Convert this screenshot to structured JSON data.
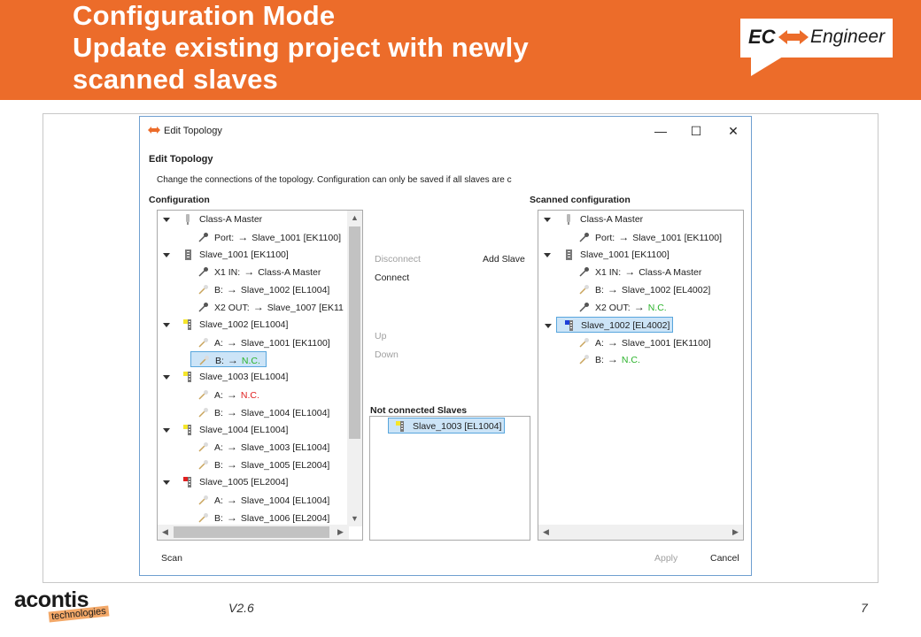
{
  "slide": {
    "title_lines": [
      "Configuration Mode",
      "Update existing project with newly",
      "scanned slaves"
    ],
    "version": "V2.6",
    "page_number": "7",
    "accent_color": "#ec6c2a"
  },
  "logo": {
    "ec": "EC",
    "engineer": "Engineer"
  },
  "brand": {
    "name": "acontis",
    "sub": "technologies"
  },
  "dialog": {
    "title": "Edit Topology",
    "heading": "Edit Topology",
    "description": "Change the connections of the topology. Configuration can only be saved if all slaves are c",
    "window_buttons": {
      "minimize": "—",
      "maximize": "☐",
      "close": "✕"
    },
    "configuration": {
      "label": "Configuration",
      "rows": [
        {
          "kind": "node",
          "icon": "master-icon",
          "text": "Class-A Master"
        },
        {
          "kind": "port",
          "icon": "port-connected-icon",
          "port": "Port:",
          "target": "Slave_1001 [EK1100]"
        },
        {
          "kind": "node",
          "icon": "slave-gray-icon",
          "text": "Slave_1001 [EK1100]"
        },
        {
          "kind": "port",
          "icon": "port-connected-icon",
          "port": "X1 IN:",
          "target": "Class-A Master"
        },
        {
          "kind": "port",
          "icon": "port-open-icon",
          "port": "B:",
          "target": "Slave_1002 [EL1004]"
        },
        {
          "kind": "port",
          "icon": "port-connected-icon",
          "port": "X2 OUT:",
          "target": "Slave_1007 [EK11"
        },
        {
          "kind": "node",
          "icon": "slave-yellow-icon",
          "text": "Slave_1002 [EL1004]"
        },
        {
          "kind": "port",
          "icon": "port-open-icon",
          "port": "A:",
          "target": "Slave_1001 [EK1100]"
        },
        {
          "kind": "port",
          "icon": "port-open-icon",
          "port": "B:",
          "target": "N.C.",
          "status": "green",
          "selected": true
        },
        {
          "kind": "node",
          "icon": "slave-yellow-icon",
          "text": "Slave_1003 [EL1004]"
        },
        {
          "kind": "port",
          "icon": "port-open-icon",
          "port": "A:",
          "target": "N.C.",
          "status": "red"
        },
        {
          "kind": "port",
          "icon": "port-open-icon",
          "port": "B:",
          "target": "Slave_1004 [EL1004]"
        },
        {
          "kind": "node",
          "icon": "slave-yellow-icon",
          "text": "Slave_1004 [EL1004]"
        },
        {
          "kind": "port",
          "icon": "port-open-icon",
          "port": "A:",
          "target": "Slave_1003 [EL1004]"
        },
        {
          "kind": "port",
          "icon": "port-open-icon",
          "port": "B:",
          "target": "Slave_1005 [EL2004]"
        },
        {
          "kind": "node",
          "icon": "slave-red-icon",
          "text": "Slave_1005 [EL2004]"
        },
        {
          "kind": "port",
          "icon": "port-open-icon",
          "port": "A:",
          "target": "Slave_1004 [EL1004]"
        },
        {
          "kind": "port",
          "icon": "port-open-icon",
          "port": "B:",
          "target": "Slave_1006 [EL2004]"
        }
      ]
    },
    "commands": {
      "disconnect": "Disconnect",
      "add_slave": "Add Slave",
      "connect": "Connect",
      "up": "Up",
      "down": "Down"
    },
    "not_connected": {
      "label": "Not connected Slaves",
      "items": [
        "Slave_1003 [EL1004]"
      ]
    },
    "scanned": {
      "label": "Scanned configuration",
      "rows": [
        {
          "kind": "node",
          "icon": "master-icon",
          "text": "Class-A Master"
        },
        {
          "kind": "port",
          "icon": "port-connected-icon",
          "port": "Port:",
          "target": "Slave_1001 [EK1100]"
        },
        {
          "kind": "node",
          "icon": "slave-gray-icon",
          "text": "Slave_1001 [EK1100]"
        },
        {
          "kind": "port",
          "icon": "port-connected-icon",
          "port": "X1 IN:",
          "target": "Class-A Master"
        },
        {
          "kind": "port",
          "icon": "port-open-icon",
          "port": "B:",
          "target": "Slave_1002 [EL4002]"
        },
        {
          "kind": "port",
          "icon": "port-connected-icon",
          "port": "X2 OUT:",
          "target": "N.C.",
          "status": "green"
        },
        {
          "kind": "node",
          "icon": "slave-blue-icon",
          "text": "Slave_1002 [EL4002]",
          "selected": true
        },
        {
          "kind": "port",
          "icon": "port-open-icon",
          "port": "A:",
          "target": "Slave_1001 [EK1100]"
        },
        {
          "kind": "port",
          "icon": "port-open-icon",
          "port": "B:",
          "target": "N.C.",
          "status": "green"
        }
      ]
    },
    "footer": {
      "scan": "Scan",
      "apply": "Apply",
      "cancel": "Cancel"
    }
  }
}
